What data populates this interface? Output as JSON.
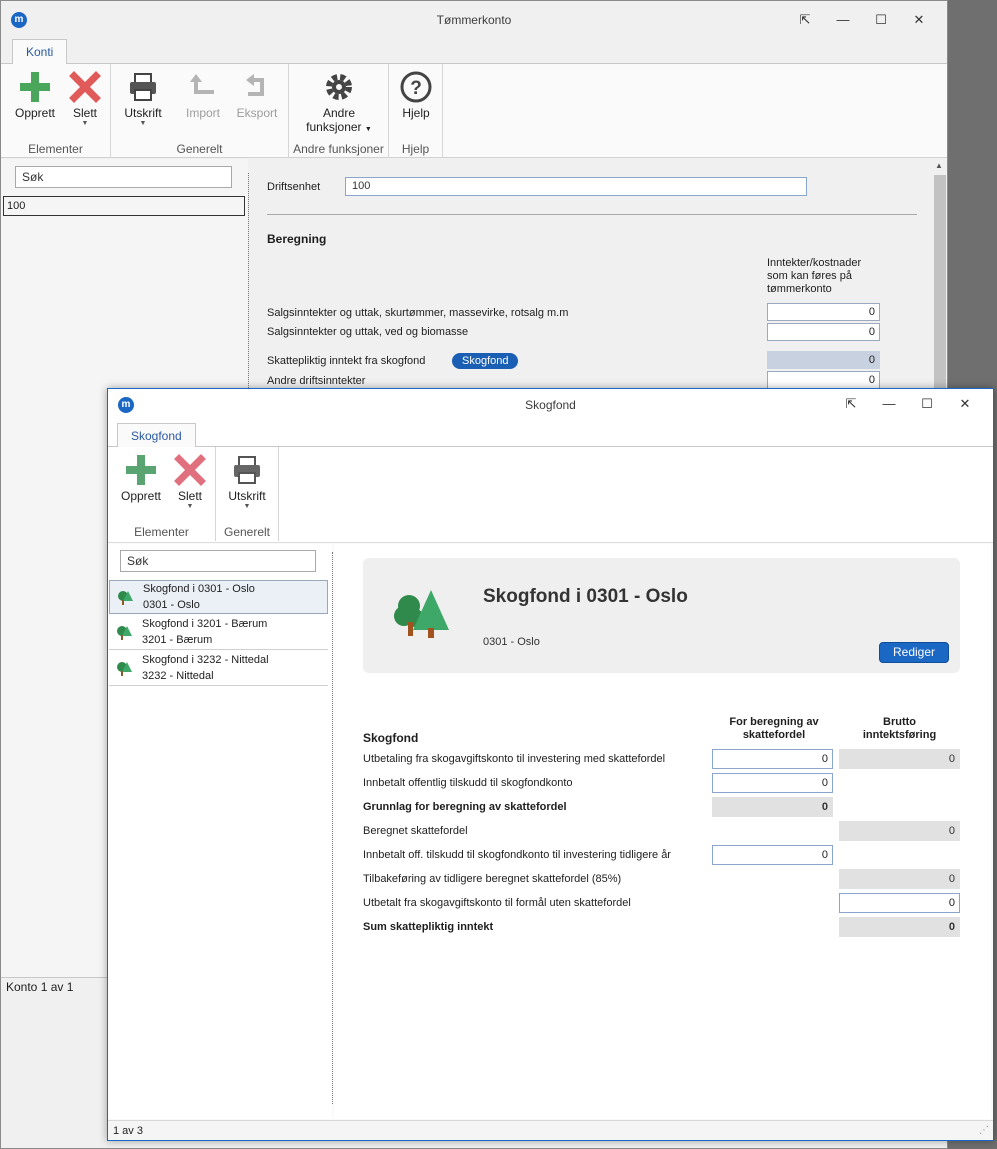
{
  "bg_window": {
    "title": "Tømmerkonto",
    "tab": "Konti",
    "ribbon": {
      "create": "Opprett",
      "delete": "Slett",
      "print": "Utskrift",
      "import": "Import",
      "export": "Eksport",
      "other_functions_1": "Andre",
      "other_functions_2": "funksjoner",
      "help": "Hjelp",
      "group_elements": "Elementer",
      "group_general": "Generelt",
      "group_other": "Andre funksjoner",
      "group_help": "Hjelp"
    },
    "search_placeholder": "Søk",
    "list": [
      "100"
    ],
    "status": "Konto 1 av 1",
    "form": {
      "operating_unit_label": "Driftsenhet",
      "operating_unit_value": "100",
      "section": "Beregning",
      "col_header_1": "Inntekter/kostnader",
      "col_header_2": "som kan føres på",
      "col_header_3": "tømmerkonto",
      "rows": [
        {
          "label": "Salgsinntekter og uttak, skurtømmer, massevirke, rotsalg m.m",
          "value": "0"
        },
        {
          "label": "Salgsinntekter og uttak, ved og biomasse",
          "value": "0"
        },
        {
          "label": "Skattepliktig inntekt fra skogfond",
          "value": "0",
          "pill": "Skogfond"
        },
        {
          "label": "Andre driftsinntekter",
          "value": "0"
        }
      ]
    }
  },
  "fg_window": {
    "title": "Skogfond",
    "tab": "Skogfond",
    "ribbon": {
      "create": "Opprett",
      "delete": "Slett",
      "print": "Utskrift",
      "group_elements": "Elementer",
      "group_general": "Generelt"
    },
    "search_placeholder": "Søk",
    "funds": [
      {
        "line1": "Skogfond i 0301 - Oslo",
        "line2": "0301 - Oslo"
      },
      {
        "line1": "Skogfond i 3201 - Bærum",
        "line2": "3201 - Bærum"
      },
      {
        "line1": "Skogfond i 3232 - Nittedal",
        "line2": "3232 - Nittedal"
      }
    ],
    "card": {
      "title": "Skogfond i 0301 - Oslo",
      "subtitle": "0301 - Oslo",
      "edit_button": "Rediger"
    },
    "table": {
      "section": "Skogfond",
      "col1_a": "For beregning av",
      "col1_b": "skattefordel",
      "col2_a": "Brutto",
      "col2_b": "inntektsføring",
      "rows": [
        {
          "label": "Utbetaling fra skogavgiftskonto til investering med skattefordel",
          "col1": "0",
          "col2": "0"
        },
        {
          "label": "Innbetalt offentlig tilskudd til skogfondkonto",
          "col1": "0"
        },
        {
          "label": "Grunnlag for beregning av skattefordel",
          "col1": "0"
        },
        {
          "label": "Beregnet skattefordel",
          "col2": "0"
        },
        {
          "label": "Innbetalt off. tilskudd til skogfondkonto til investering tidligere år",
          "col1": "0"
        },
        {
          "label": "Tilbakeføring av tidligere beregnet skattefordel  (85%)",
          "col2": "0"
        },
        {
          "label": "Utbetalt fra skogavgiftskonto til formål uten skattefordel",
          "col2": "0"
        },
        {
          "label": "Sum skattepliktig inntekt",
          "col2": "0"
        }
      ]
    },
    "status": "1 av 3"
  }
}
